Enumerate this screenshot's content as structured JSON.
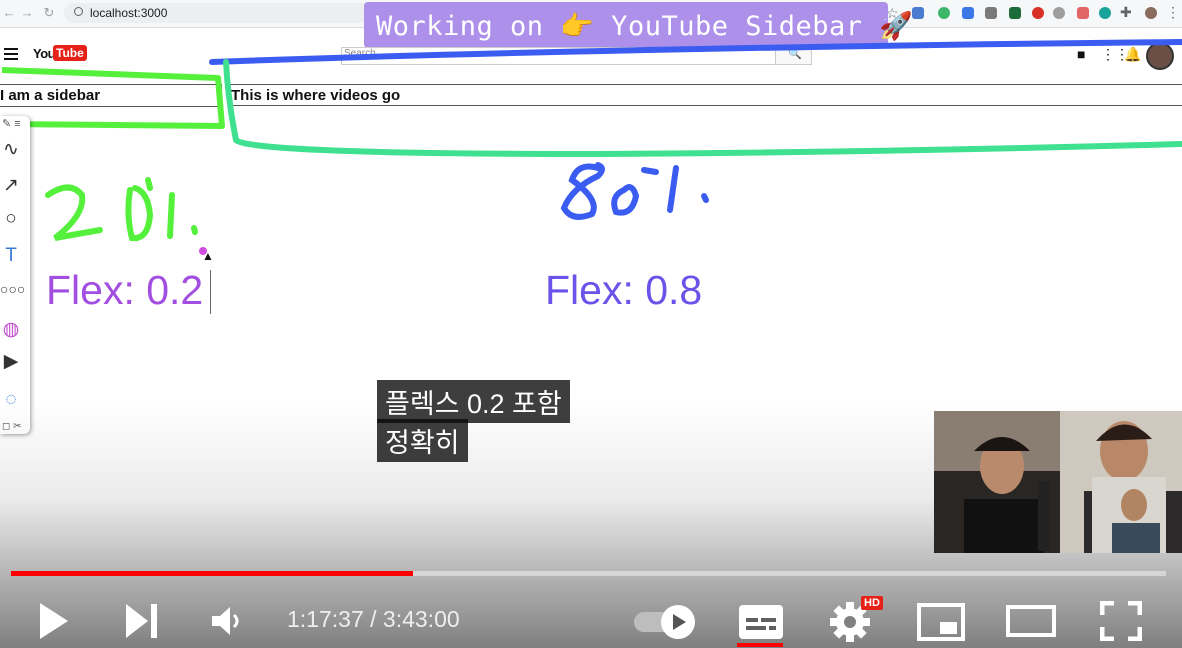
{
  "browser": {
    "url": "localhost:3000"
  },
  "title_banner": "Working on 👉 YouTube Sidebar 🚀",
  "youtube_header": {
    "logo_you": "You",
    "logo_tube": "Tube",
    "search_placeholder": "Search"
  },
  "layout": {
    "sidebar_text": "I am a sidebar",
    "videos_text": "This is where videos go"
  },
  "annotations": {
    "left_percent": "20%",
    "right_percent": "80%",
    "flex_left": "Flex: 0.2",
    "flex_right": "Flex: 0.8"
  },
  "subtitles": {
    "line1": "플렉스 0.2 포함",
    "line2": "정확히"
  },
  "player": {
    "time_display": "1:17:37 / 3:43:00",
    "progress": 0.348,
    "hd_badge": "HD",
    "autoplay": "on"
  },
  "colors": {
    "progress": "#ff0000",
    "flex_left": "#a24ee0",
    "flex_right": "#6b52e8",
    "green_marker": "#55f03c",
    "blue_marker": "#3b5cf0"
  },
  "icons": [
    "back-arrow-icon",
    "forward-arrow-icon",
    "reload-icon",
    "star-icon",
    "extensions-icon",
    "menu-icon",
    "search-icon",
    "video-camera-icon",
    "apps-grid-icon",
    "bell-icon",
    "pen-icon",
    "curve-icon",
    "arrow-icon",
    "circle-icon",
    "text-icon",
    "chain-icon",
    "color-wheel-icon",
    "play-circle-icon",
    "timer-icon",
    "play-icon",
    "next-icon",
    "volume-icon",
    "autoplay-toggle-icon",
    "subtitles-icon",
    "gear-icon",
    "miniplayer-icon",
    "theater-icon",
    "fullscreen-icon"
  ]
}
